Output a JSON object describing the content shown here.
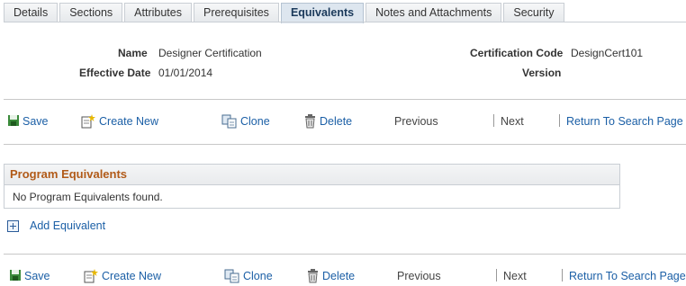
{
  "tabs": [
    {
      "label": "Details",
      "active": false
    },
    {
      "label": "Sections",
      "active": false
    },
    {
      "label": "Attributes",
      "active": false
    },
    {
      "label": "Prerequisites",
      "active": false
    },
    {
      "label": "Equivalents",
      "active": true
    },
    {
      "label": "Notes and Attachments",
      "active": false
    },
    {
      "label": "Security",
      "active": false
    }
  ],
  "header": {
    "name_label": "Name",
    "name_value": "Designer Certification",
    "effective_date_label": "Effective Date",
    "effective_date_value": "01/01/2014",
    "cert_code_label": "Certification Code",
    "cert_code_value": "DesignCert101",
    "version_label": "Version",
    "version_value": ""
  },
  "toolbar": {
    "save": "Save",
    "create_new": "Create New",
    "clone": "Clone",
    "delete": "Delete",
    "previous": "Previous",
    "next": "Next",
    "return_search": "Return To Search Page"
  },
  "program_equivalents": {
    "title": "Program Equivalents",
    "empty_message": "No Program Equivalents found."
  },
  "add_equivalent": "Add Equivalent",
  "colors": {
    "link": "#1b5fa6",
    "grid_title": "#b15a18",
    "active_tab": "#dde6ef"
  }
}
